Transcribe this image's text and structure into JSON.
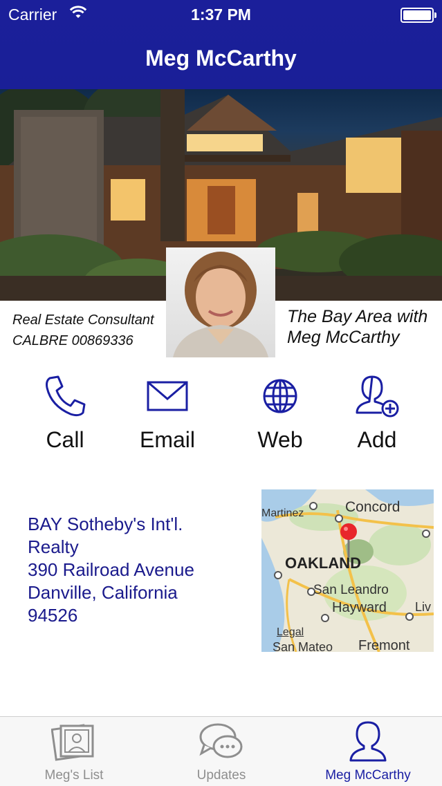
{
  "status_bar": {
    "carrier": "Carrier",
    "time": "1:37 PM"
  },
  "header": {
    "title": "Meg McCarthy"
  },
  "profile": {
    "role_line1": "Real Estate Consultant",
    "role_line2": "CALBRE 00869336",
    "tagline_line1": "The Bay Area with",
    "tagline_line2": "Meg McCarthy"
  },
  "actions": [
    {
      "label": "Call",
      "icon": "phone-icon"
    },
    {
      "label": "Email",
      "icon": "envelope-icon"
    },
    {
      "label": "Web",
      "icon": "globe-icon"
    },
    {
      "label": "Add",
      "icon": "add-contact-icon"
    }
  ],
  "address": {
    "line1": "BAY Sotheby's Int'l.",
    "line2": "Realty",
    "line3": "390 Railroad Avenue",
    "line4": "Danville, California",
    "line5": "94526"
  },
  "map": {
    "labels": [
      "Martinez",
      "Concord",
      "OAKLAND",
      "San Leandro",
      "Hayward",
      "Fremont",
      "San Mateo",
      "Legal",
      "Liv"
    ]
  },
  "tabs": [
    {
      "label": "Meg's List",
      "icon": "photos-icon",
      "active": false
    },
    {
      "label": "Updates",
      "icon": "chat-bubbles-icon",
      "active": false
    },
    {
      "label": "Meg McCarthy",
      "icon": "person-icon",
      "active": true
    }
  ],
  "colors": {
    "brand": "#1a1f9a",
    "link": "#1a1a8c",
    "inactive": "#8e8e8e"
  }
}
